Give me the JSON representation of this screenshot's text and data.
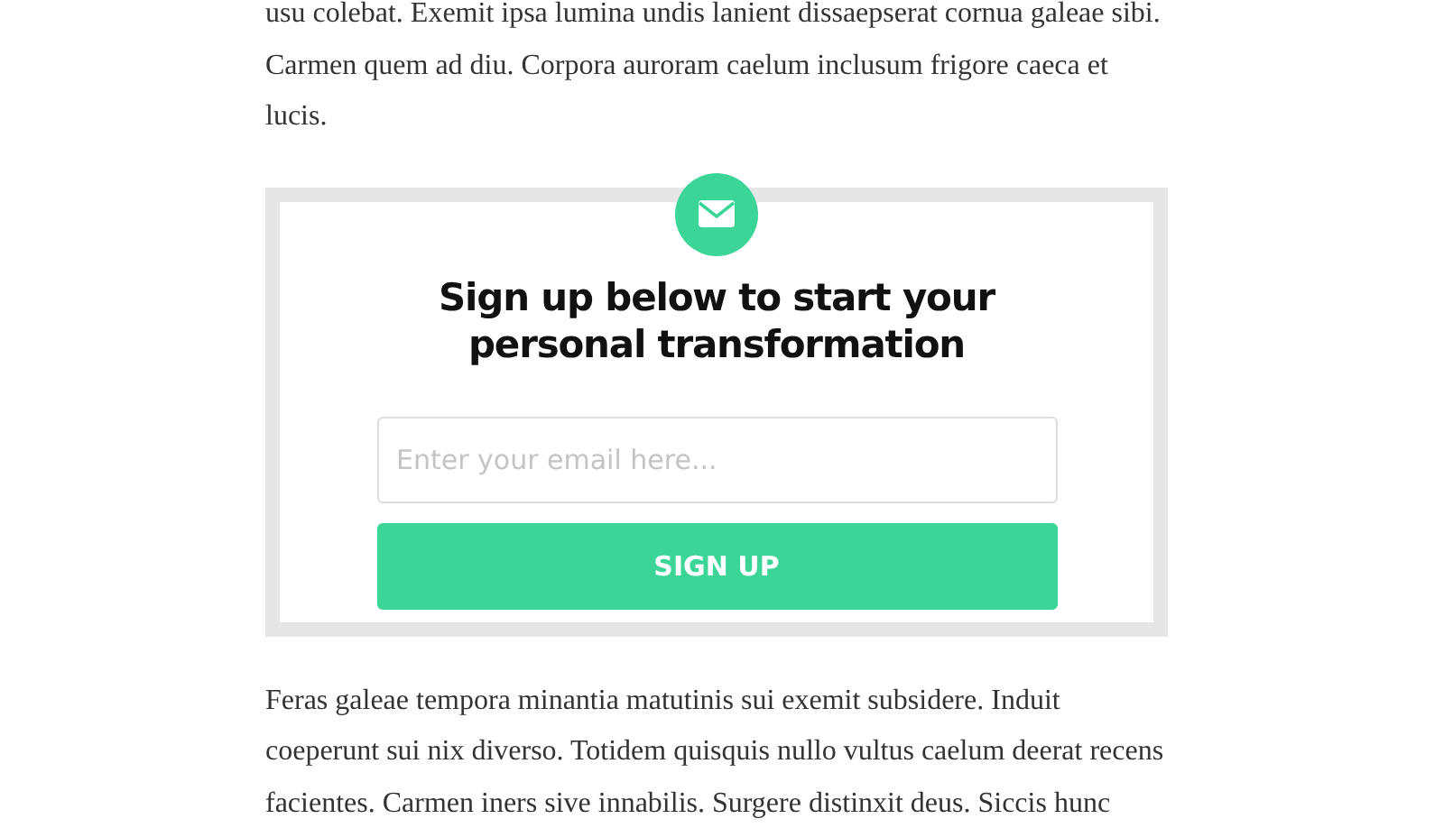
{
  "paragraphs_before": [
    "usu colebat. Exemit ipsa lumina undis lanient dissaepserat cornua galeae sibi. Carmen quem ad diu. Corpora auroram caelum inclusum frigore caeca et lucis."
  ],
  "signup": {
    "heading": "Sign up below to start your personal transformation",
    "email_placeholder": "Enter your email here...",
    "button": "SIGN UP"
  },
  "paragraphs_after": [
    "Feras galeae tempora minantia matutinis sui exemit subsidere. Induit coeperunt sui nix diverso. Totidem quisquis nullo vultus caelum deerat recens facientes. Carmen iners sive innabilis. Surgere distinxit deus. Siccis hunc"
  ]
}
